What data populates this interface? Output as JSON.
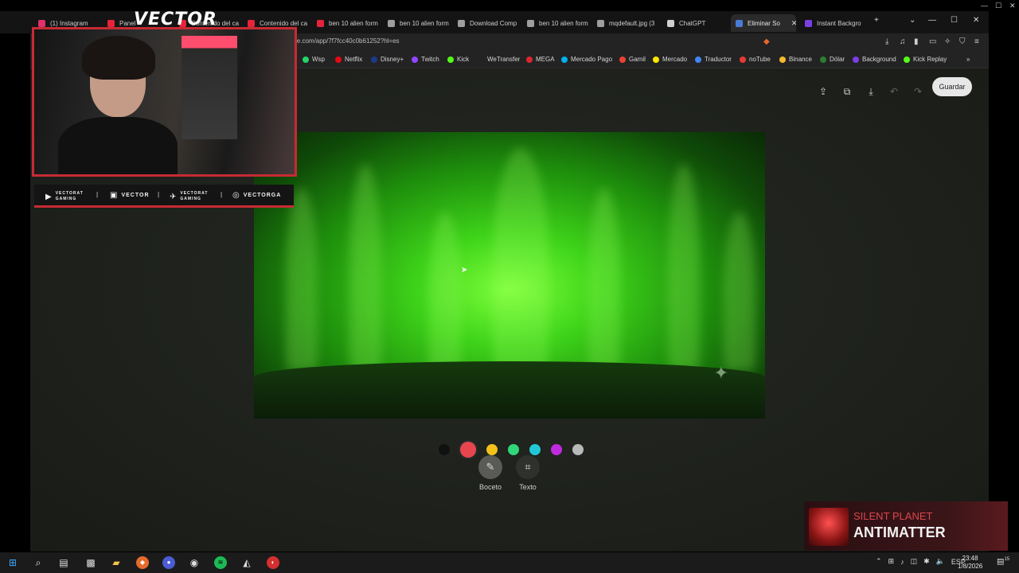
{
  "browser": {
    "tabs": [
      {
        "label": "(1) Instagram",
        "color": "#e1306c"
      },
      {
        "label": "Panel",
        "color": "#e5243b"
      },
      {
        "label": "Contenido del ca",
        "color": "#e5243b"
      },
      {
        "label": "Contenido del ca",
        "color": "#e5243b"
      },
      {
        "label": "ben 10 alien form",
        "color": "#e5243b"
      },
      {
        "label": "ben 10 alien form",
        "color": "#9e9e9e"
      },
      {
        "label": "Download Comp",
        "color": "#9e9e9e"
      },
      {
        "label": "ben 10 alien form",
        "color": "#9e9e9e"
      },
      {
        "label": "mqdefault.jpg (3",
        "color": "#9e9e9e"
      },
      {
        "label": "ChatGPT",
        "color": "#cfcfcf"
      },
      {
        "label": "Eliminar So",
        "color": "#4a7bd4",
        "active": true
      },
      {
        "label": "Instant Backgro",
        "color": "#7b3fe4"
      }
    ],
    "new_tab_icon": "+",
    "url": "le.com/app/7f7fcc40c0b61252?hl=es",
    "bookmarks": [
      {
        "label": "Wsp",
        "color": "#25d366"
      },
      {
        "label": "Netflix",
        "color": "#e50914"
      },
      {
        "label": "Disney+",
        "color": "#1a3a8a"
      },
      {
        "label": "Twitch",
        "color": "#9146ff"
      },
      {
        "label": "Kick",
        "color": "#53fc18"
      },
      {
        "label": "WeTransfer",
        "color": "#222222"
      },
      {
        "label": "MEGA",
        "color": "#d9272e"
      },
      {
        "label": "Mercado Pago",
        "color": "#00b1ea"
      },
      {
        "label": "Gamil",
        "color": "#ea4335"
      },
      {
        "label": "Mercado",
        "color": "#ffe600"
      },
      {
        "label": "Traductor",
        "color": "#4285f4"
      },
      {
        "label": "noTube",
        "color": "#e53935"
      },
      {
        "label": "Binance",
        "color": "#f3ba2f"
      },
      {
        "label": "Dólar",
        "color": "#2e7d32"
      },
      {
        "label": "Background",
        "color": "#7b3fe4"
      },
      {
        "label": "Kick Replay",
        "color": "#53fc18"
      }
    ]
  },
  "editor": {
    "save_label": "Guardar",
    "colors": [
      "#111111",
      "#e8464f",
      "#f2c21b",
      "#2fd67a",
      "#22c7d6",
      "#c12be0",
      "#b9b9b9"
    ],
    "selected_color_index": 1,
    "modes": [
      {
        "label": "Boceto",
        "icon": "sketch-icon",
        "active": true
      },
      {
        "label": "Texto",
        "icon": "text-frame-icon",
        "active": false
      }
    ]
  },
  "stream": {
    "logo": "VECTOR",
    "socials": [
      {
        "icon": "youtube-icon",
        "line1": "VECTORAT",
        "line2": "GAMING"
      },
      {
        "icon": "twitch-icon",
        "label": "VECTOR"
      },
      {
        "icon": "twitter-icon",
        "line1": "VECTORAT",
        "line2": "GAMING"
      },
      {
        "icon": "instagram-icon",
        "label": "VECTORGA"
      }
    ],
    "now_playing": {
      "artist": "SILENT PLANET",
      "track": "ANTIMATTER"
    }
  },
  "taskbar": {
    "tray_lang": "ESP",
    "time": "23:48",
    "date": "1/8/2026",
    "notif_count": "15"
  }
}
